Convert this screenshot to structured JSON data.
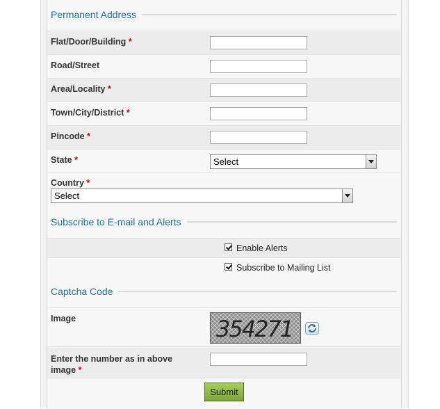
{
  "sections": {
    "permanent_address": "Permanent Address",
    "subscribe": "Subscribe to E-mail and Alerts",
    "captcha": "Captcha Code"
  },
  "required_marker": "*",
  "fields": {
    "flat": "Flat/Door/Building",
    "road": "Road/Street",
    "area": "Area/Locality",
    "town": "Town/City/District",
    "pincode": "Pincode",
    "state": "State",
    "country": "Country",
    "image": "Image",
    "captcha_input_line1": "Enter the number as in above",
    "captcha_input_line2": "image"
  },
  "selects": {
    "state_value": "Select",
    "country_value": "Select"
  },
  "checkboxes": {
    "enable_alerts": "Enable Alerts",
    "mailing_list": "Subscribe to Mailing List"
  },
  "captcha_text": "354271",
  "submit_label": "Submit",
  "colors": {
    "section_title": "#1f6f9a",
    "required": "#cc0000",
    "submit_bg": "#8fb84a"
  }
}
